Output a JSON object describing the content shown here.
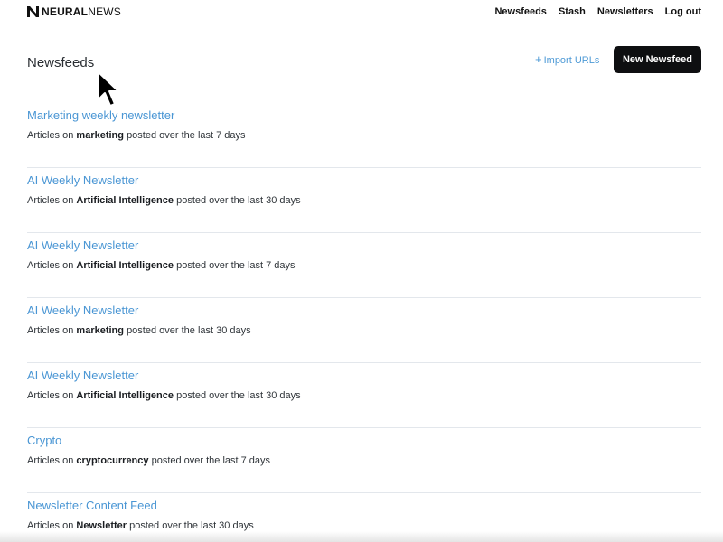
{
  "brand": {
    "name_bold": "NEURAL",
    "name_light": "NEWS",
    "logo_icon": "neural-n-logo-icon"
  },
  "nav": {
    "items": [
      {
        "label": "Newsfeeds"
      },
      {
        "label": "Stash"
      },
      {
        "label": "Newsletters"
      },
      {
        "label": "Log out"
      }
    ]
  },
  "header": {
    "title": "Newsfeeds",
    "import_icon": "plus-icon",
    "import_plus": "+",
    "import_label": "Import URLs",
    "new_button_label": "New Newsfeed"
  },
  "feeds": [
    {
      "title": "Marketing weekly newsletter",
      "prefix": "Articles on",
      "topic": "marketing",
      "suffix": "posted over the last 7 days"
    },
    {
      "title": "AI Weekly Newsletter",
      "prefix": "Articles on",
      "topic": "Artificial Intelligence",
      "suffix": "posted over the last 30 days"
    },
    {
      "title": "AI Weekly Newsletter",
      "prefix": "Articles on",
      "topic": "Artificial Intelligence",
      "suffix": "posted over the last 7 days"
    },
    {
      "title": "AI Weekly Newsletter",
      "prefix": "Articles on",
      "topic": "marketing",
      "suffix": "posted over the last 30 days"
    },
    {
      "title": "AI Weekly Newsletter",
      "prefix": "Articles on",
      "topic": "Artificial Intelligence",
      "suffix": "posted over the last 30 days"
    },
    {
      "title": "Crypto",
      "prefix": "Articles on",
      "topic": "cryptocurrency",
      "suffix": "posted over the last 7 days"
    },
    {
      "title": "Newsletter Content Feed",
      "prefix": "Articles on",
      "topic": "Newsletter",
      "suffix": "posted over the last 30 days"
    }
  ],
  "colors": {
    "link": "#4a96d4",
    "button_bg": "#0e0f11",
    "divider": "#e3e7ec"
  }
}
